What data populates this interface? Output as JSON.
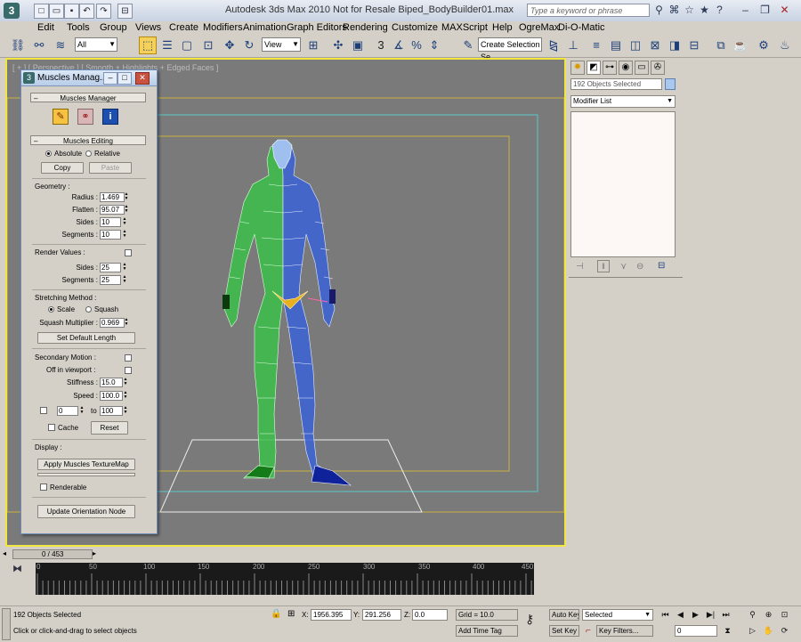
{
  "titlebar": {
    "logo": "3",
    "title": "Autodesk 3ds Max  2010      Not for Resale      Biped_BodyBuilder01.max",
    "search_placeholder": "Type a keyword or phrase"
  },
  "menu": [
    "Edit",
    "Tools",
    "Group",
    "Views",
    "Create",
    "Modifiers",
    "Animation",
    "Graph Editors",
    "Rendering",
    "Customize",
    "MAXScript",
    "Help",
    "OgreMax",
    "Di-O-Matic"
  ],
  "toolbar": {
    "filter_value": "All",
    "refcoord_value": "View",
    "selection_set_value": "Create Selection Se",
    "snap_label": "3"
  },
  "viewport": {
    "label": "[ + ] [ Perspective ] [ Smooth + Highlights + Edged Faces ]"
  },
  "panel": {
    "title": "Muscles Manag...",
    "manager_header": "Muscles Manager",
    "editing_header": "Muscles Editing",
    "absolute_label": "Absolute",
    "relative_label": "Relative",
    "copy_label": "Copy",
    "paste_label": "Paste",
    "geometry_label": "Geometry :",
    "radius_label": "Radius :",
    "radius_value": "1.469",
    "flatten_label": "Flatten :",
    "flatten_value": "95.07",
    "sides_label": "Sides :",
    "sides_value": "10",
    "segments_label": "Segments :",
    "segments_value": "10",
    "render_values_label": "Render Values :",
    "render_sides_label": "Sides :",
    "render_sides_value": "25",
    "render_segments_label": "Segments :",
    "render_segments_value": "25",
    "stretching_label": "Stretching Method :",
    "scale_label": "Scale",
    "squash_label": "Squash",
    "squash_mult_label": "Squash Multiplier :",
    "squash_mult_value": "0.969",
    "set_default_length_label": "Set Default Length",
    "secondary_motion_label": "Secondary Motion :",
    "off_in_viewport_label": "Off in viewport :",
    "stiffness_label": "Stiffness :",
    "stiffness_value": "15.0",
    "speed_label": "Speed :",
    "speed_value": "100.0",
    "range_from_value": "0",
    "range_to_label": "to",
    "range_to_value": "100",
    "cache_label": "Cache",
    "reset_label": "Reset",
    "display_label": "Display :",
    "apply_texture_label": "Apply Muscles TextureMap",
    "renderable_label": "Renderable",
    "update_orientation_label": "Update Orientation Node"
  },
  "command_panel": {
    "selection_name": "192 Objects Selected",
    "modifier_list": "Modifier List"
  },
  "timeline": {
    "frame_counter": "0 / 453",
    "ticks": [
      "0",
      "50",
      "100",
      "150",
      "200",
      "250",
      "300",
      "350",
      "400",
      "450"
    ]
  },
  "status": {
    "selection_info": "192 Objects Selected",
    "prompt": "Click or click-and-drag to select objects",
    "x_label": "X:",
    "x_value": "1956.395",
    "y_label": "Y:",
    "y_value": "291.256",
    "z_label": "Z:",
    "z_value": "0.0",
    "grid": "Grid = 10.0",
    "add_time_tag": "Add Time Tag",
    "auto_key": "Auto Key",
    "set_key": "Set Key",
    "key_filter_value": "Selected",
    "key_filters": "Key Filters...",
    "current_frame": "0"
  }
}
